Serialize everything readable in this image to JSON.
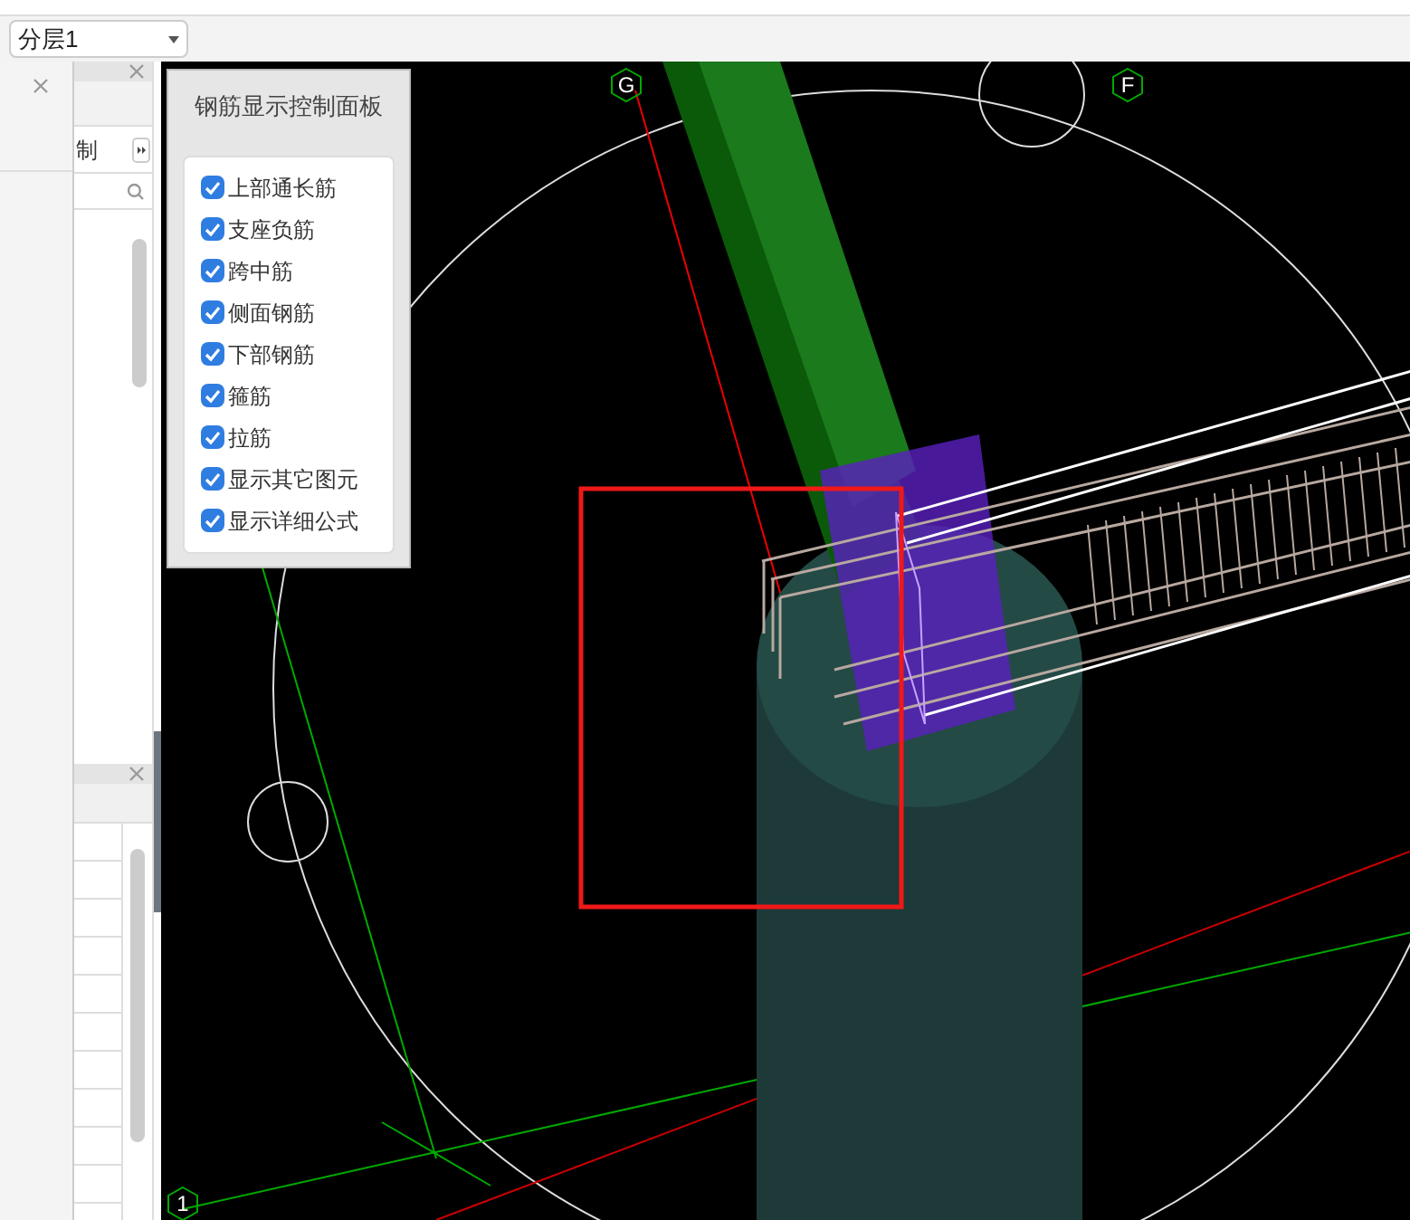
{
  "toolbar": {
    "layer_select": "分层1"
  },
  "side_panel": {
    "button": "制"
  },
  "viewport": {
    "axis_labels": [
      "G",
      "F",
      "1"
    ]
  },
  "rebar_panel": {
    "title": "钢筋显示控制面板",
    "options": [
      {
        "label": "上部通长筋",
        "checked": true
      },
      {
        "label": "支座负筋",
        "checked": true
      },
      {
        "label": "跨中筋",
        "checked": true
      },
      {
        "label": "侧面钢筋",
        "checked": true
      },
      {
        "label": "下部钢筋",
        "checked": true
      },
      {
        "label": "箍筋",
        "checked": true
      },
      {
        "label": "拉筋",
        "checked": true
      },
      {
        "label": "显示其它图元",
        "checked": true
      },
      {
        "label": "显示详细公式",
        "checked": true
      }
    ]
  }
}
